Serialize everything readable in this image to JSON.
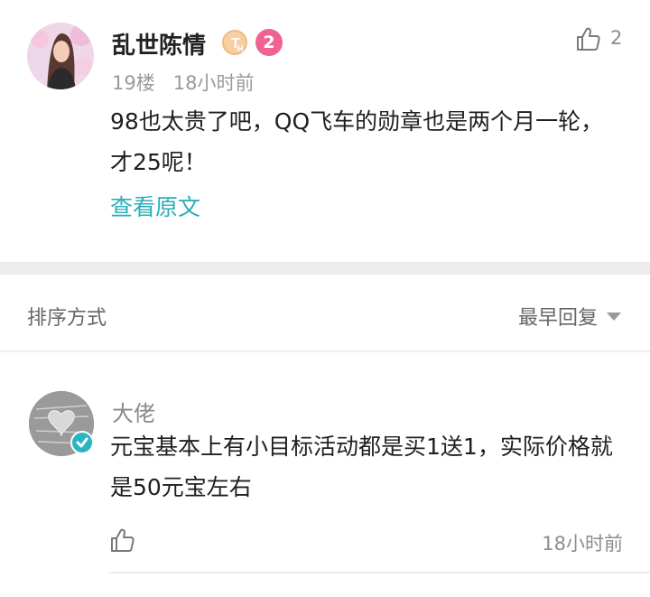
{
  "post": {
    "author": "乱世陈情",
    "level_badge": "T",
    "level_sub": "H",
    "rank_badge": "2",
    "floor": "19楼",
    "time": "18小时前",
    "like_count": "2",
    "text": "98也太贵了吧，QQ飞车的勋章也是两个月一轮，才25呢！",
    "view_original": "查看原文"
  },
  "sort": {
    "label": "排序方式",
    "option": "最早回复"
  },
  "reply": {
    "name": "大佬",
    "text": "元宝基本上有小目标活动都是买1送1，实际价格就是50元宝左右",
    "time": "18小时前"
  },
  "colors": {
    "accent": "#2aaeb8",
    "badge_pink": "#f06292",
    "badge_gold": "#f3c08a",
    "divider": "#ececec"
  },
  "icons": {
    "like": "thumbs-up-icon",
    "caret": "caret-down-icon",
    "verified": "verified-check-icon"
  }
}
